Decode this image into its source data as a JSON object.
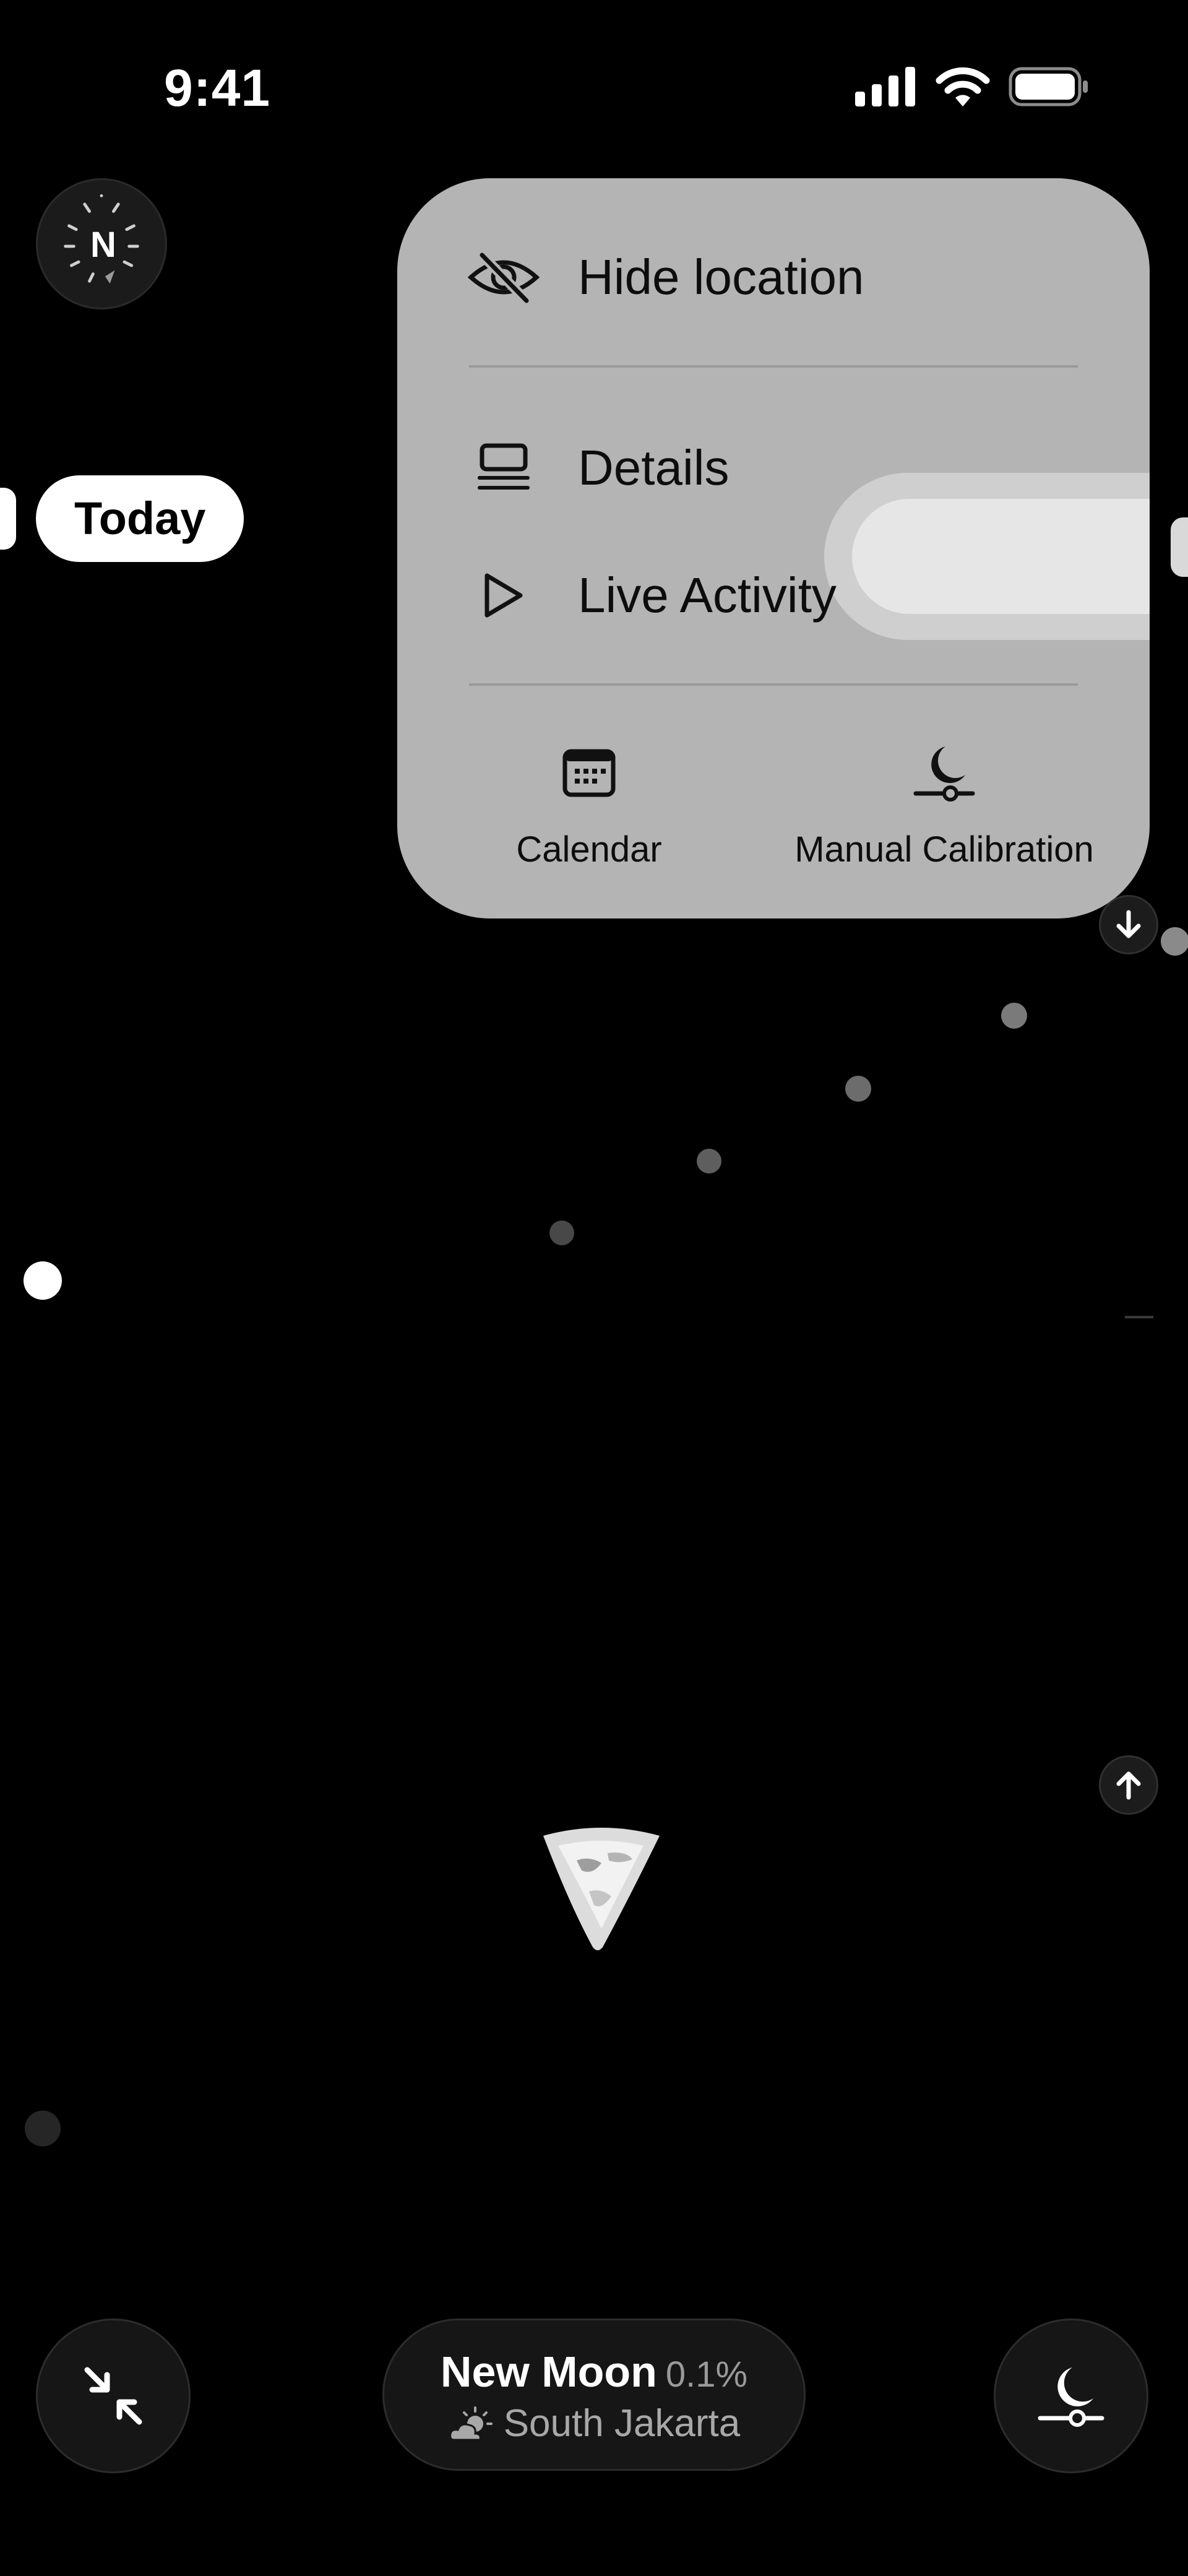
{
  "status_bar": {
    "time": "9:41",
    "icons": [
      "cellular-signal-icon",
      "wifi-icon",
      "battery-icon"
    ]
  },
  "compass": {
    "label": "N"
  },
  "timeline": {
    "today_label": "Today"
  },
  "context_menu": {
    "items": [
      {
        "label": "Hide location",
        "icon": "eye-slash-icon"
      },
      {
        "label": "Details",
        "icon": "details-list-icon"
      },
      {
        "label": "Live Activity",
        "icon": "play-icon"
      }
    ],
    "tiles": [
      {
        "label": "Calendar",
        "icon": "calendar-icon"
      },
      {
        "label": "Manual Calibration",
        "icon": "moon-slider-icon"
      }
    ]
  },
  "moon_info": {
    "phase": "New Moon",
    "illumination": "0.1%",
    "location": "South Jakarta",
    "weather_icon": "partly-sunny-icon"
  },
  "controls": {
    "collapse_icon": "collapse-arrows-icon",
    "calibration_icon": "moon-slider-icon",
    "scroll_down_icon": "arrow-down-icon",
    "scroll_up_icon": "arrow-up-icon"
  },
  "colors": {
    "background": "#000000",
    "menu_background": "#b4b4b4",
    "accent": "#ffffff",
    "secondary_text": "#a8a8a8"
  }
}
